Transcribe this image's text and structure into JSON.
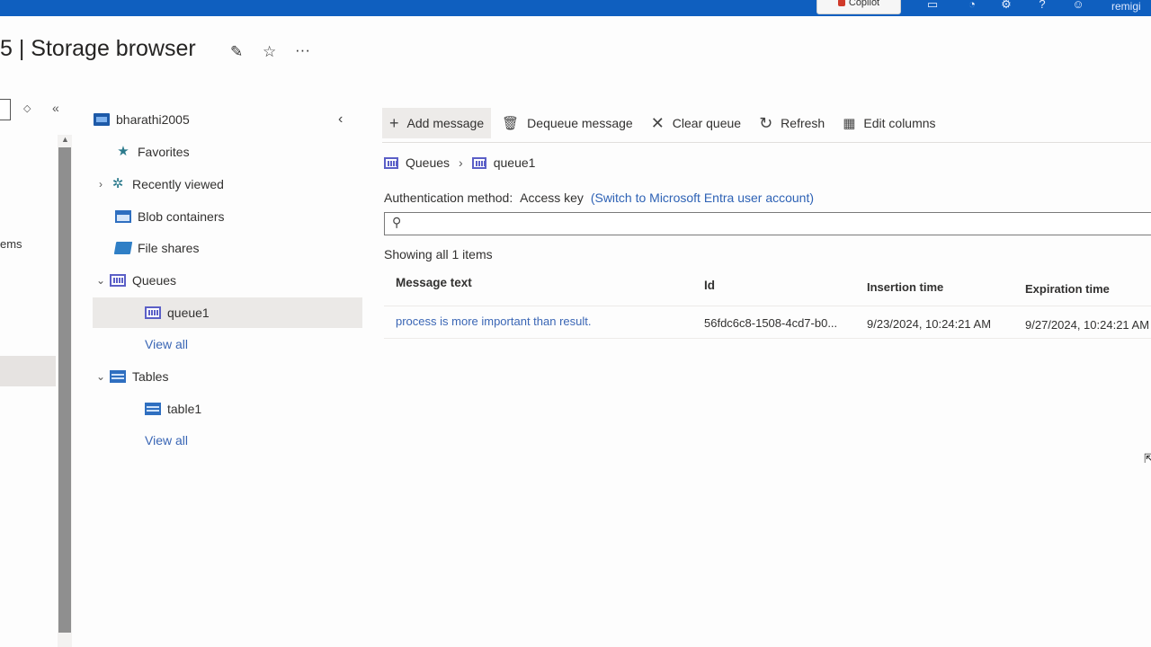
{
  "topbar": {
    "copilot_label": "Copilot",
    "user_label": "remigi"
  },
  "title": {
    "text": "5 | Storage browser"
  },
  "left_pane": {
    "partial_text": "ems"
  },
  "tree": {
    "account": "bharathi2005",
    "items": [
      {
        "label": "Favorites"
      },
      {
        "label": "Recently viewed"
      },
      {
        "label": "Blob containers"
      },
      {
        "label": "File shares"
      },
      {
        "label": "Queues"
      },
      {
        "label": "queue1"
      },
      {
        "label": "View all"
      },
      {
        "label": "Tables"
      },
      {
        "label": "table1"
      },
      {
        "label": "View all"
      }
    ]
  },
  "toolbar": {
    "add_message": "Add message",
    "dequeue_message": "Dequeue message",
    "clear_queue": "Clear queue",
    "refresh": "Refresh",
    "edit_columns": "Edit columns"
  },
  "breadcrumb": {
    "root": "Queues",
    "current": "queue1"
  },
  "auth": {
    "label": "Authentication method:",
    "value": "Access key",
    "link": "(Switch to Microsoft Entra user account)"
  },
  "search": {
    "value": "",
    "placeholder": ""
  },
  "status": {
    "showing": "Showing all 1 items"
  },
  "grid": {
    "columns": [
      "Message text",
      "Id",
      "Insertion time",
      "Expiration time"
    ],
    "rows": [
      {
        "message_text": "process is more important than result.",
        "id": "56fdc6c8-1508-4cd7-b0...",
        "insertion_time": "9/23/2024, 10:24:21 AM",
        "expiration_time": "9/27/2024, 10:24:21 AM"
      }
    ]
  }
}
